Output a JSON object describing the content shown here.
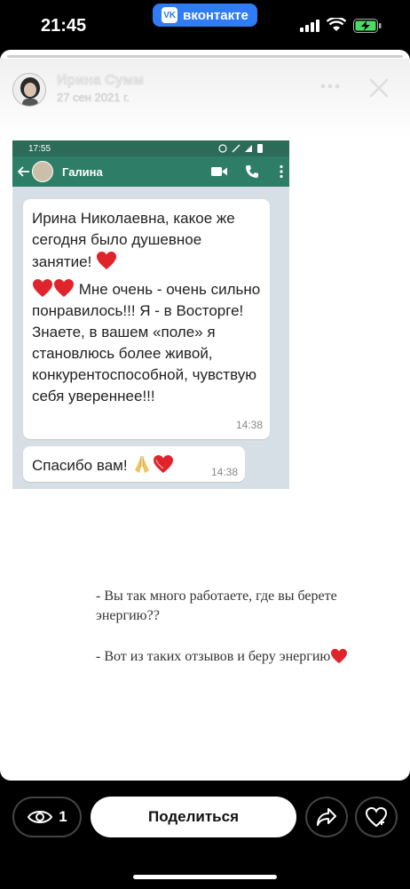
{
  "status_bar": {
    "time": "21:45",
    "app_pill": "вконтакте",
    "app_logo": "VK"
  },
  "story": {
    "author_name": "Ирина Сумм",
    "date": "27 сен 2021 г."
  },
  "whatsapp": {
    "time": "17:55",
    "contact_name": "Галина",
    "messages": [
      {
        "paragraph1": "Ирина Николаевна, какое же сегодня было душевное занятие!",
        "paragraph2": "Мне очень  - очень сильно  понравилось!!! Я - в Восторге! Знаете, в вашем «поле» я становлюсь более живой, конкурентоспособной, чувствую себя увереннее!!!",
        "time": "14:38"
      },
      {
        "text": "Спасибо вам!",
        "time": "14:38"
      }
    ]
  },
  "captions": {
    "question": "- Вы так много работаете, где вы берете энергию??",
    "answer": "- Вот из таких отзывов и беру энергию"
  },
  "bottom_bar": {
    "views_count": "1",
    "share_label": "Поделиться"
  },
  "icons": {
    "close": "close-icon",
    "more": "more-icon",
    "eye": "eye-icon",
    "share": "share-arrow-icon",
    "like": "heart-icon"
  },
  "colors": {
    "vk_blue": "#2f7cf6",
    "wa_header": "#2e7d66",
    "heart_red": "#e0242b"
  }
}
